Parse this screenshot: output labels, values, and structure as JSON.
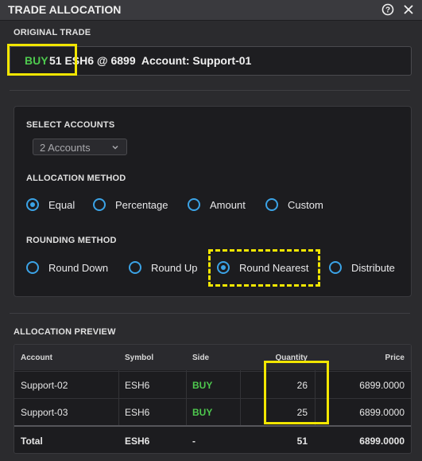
{
  "window": {
    "title": "TRADE ALLOCATION",
    "help_icon": "question-circle-icon",
    "close_icon": "close-icon"
  },
  "original_trade": {
    "label": "ORIGINAL TRADE",
    "side": "BUY",
    "details": "51 ESH6 @ 6899  Account: Support-01"
  },
  "select_accounts": {
    "label": "SELECT ACCOUNTS",
    "value": "2 Accounts"
  },
  "allocation_method": {
    "label": "ALLOCATION METHOD",
    "options": [
      "Equal",
      "Percentage",
      "Amount",
      "Custom"
    ],
    "selected": "Equal"
  },
  "rounding_method": {
    "label": "ROUNDING METHOD",
    "options": [
      "Round Down",
      "Round Up",
      "Round Nearest",
      "Distribute"
    ],
    "selected": "Round Nearest"
  },
  "preview": {
    "label": "ALLOCATION PREVIEW",
    "columns": [
      "Account",
      "Symbol",
      "Side",
      "Quantity",
      "Price"
    ],
    "rows": [
      {
        "account": "Support-02",
        "symbol": "ESH6",
        "side": "BUY",
        "quantity": "26",
        "price": "6899.0000"
      },
      {
        "account": "Support-03",
        "symbol": "ESH6",
        "side": "BUY",
        "quantity": "25",
        "price": "6899.0000"
      }
    ],
    "total": {
      "account": "Total",
      "symbol": "ESH6",
      "side": "-",
      "quantity": "51",
      "price": "6899.0000"
    }
  },
  "colors": {
    "buy": "#4ec94e",
    "radio_accent": "#3ba3e6",
    "highlight": "#f2e600"
  }
}
